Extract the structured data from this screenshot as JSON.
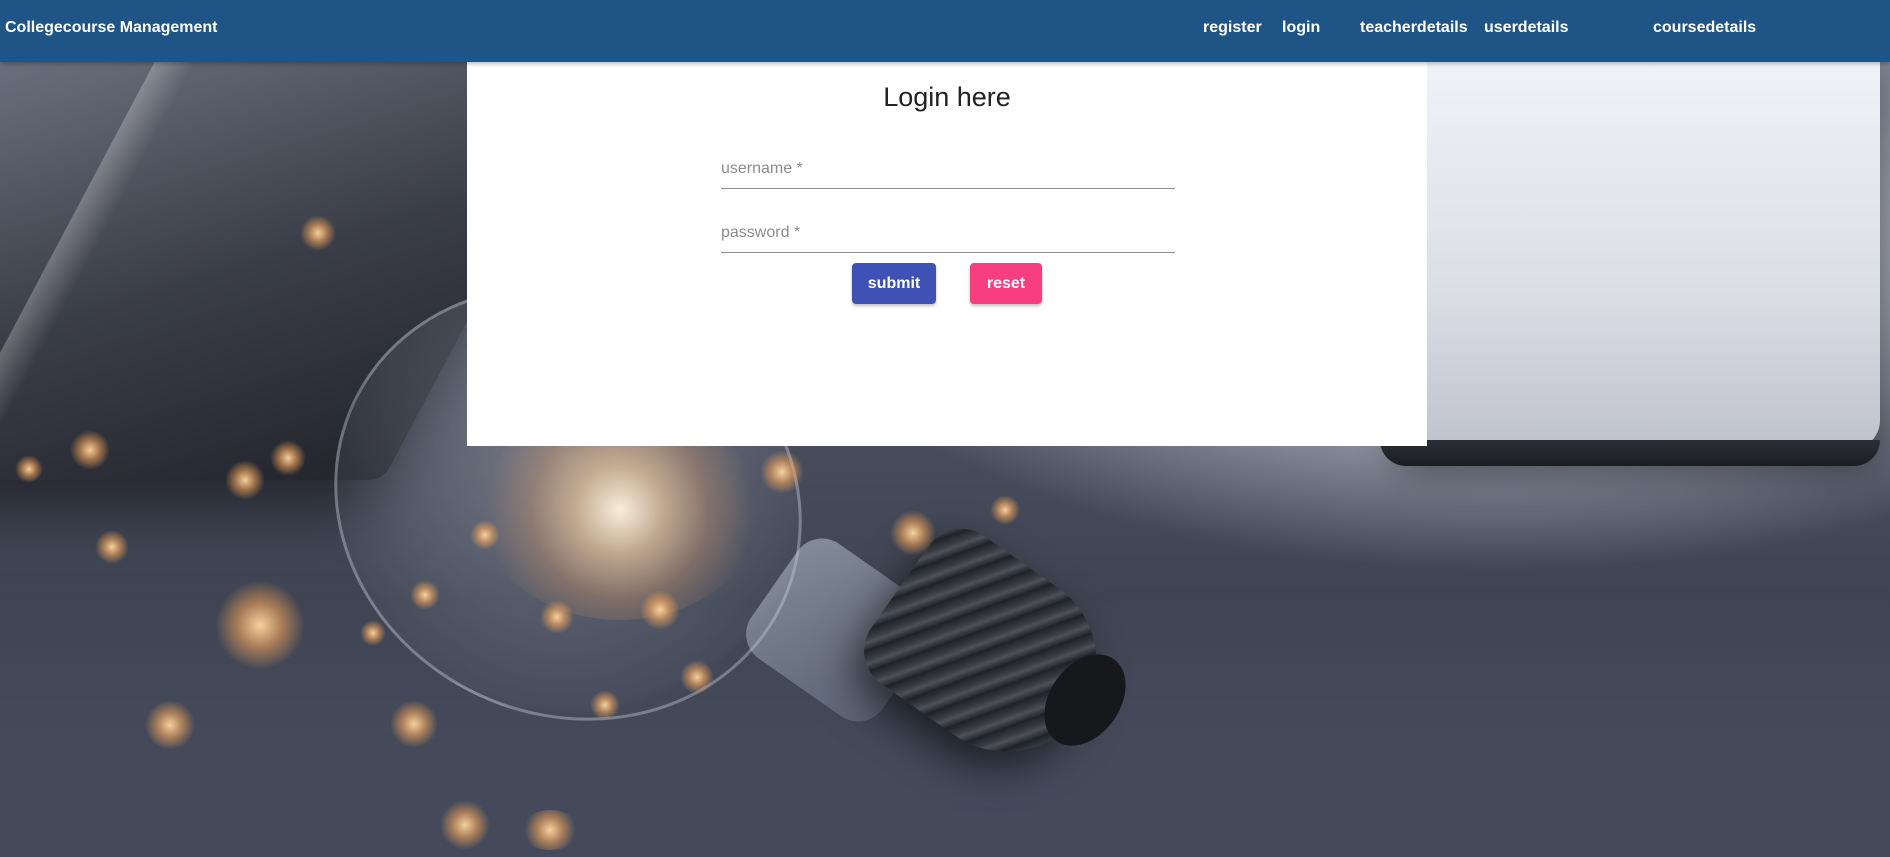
{
  "app": {
    "brand": "Collegecourse Management"
  },
  "nav": {
    "items": [
      {
        "label": "register"
      },
      {
        "label": "login"
      },
      {
        "label": "teacherdetails"
      },
      {
        "label": "userdetails"
      },
      {
        "label": "coursedetails"
      }
    ]
  },
  "login": {
    "title": "Login here",
    "username": {
      "value": "",
      "placeholder": "username *"
    },
    "password": {
      "value": "",
      "placeholder": "password *"
    },
    "submit_label": "submit",
    "reset_label": "reset"
  },
  "colors": {
    "navbar": "#1f5586",
    "submit_button": "#3f51b5",
    "reset_button": "#f73f7f",
    "card": "#ffffff"
  },
  "background": {
    "description_icon": "lightbulb-laptop-photo"
  }
}
